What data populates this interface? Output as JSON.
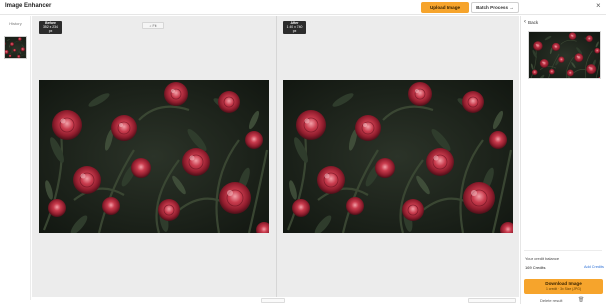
{
  "app": {
    "title": "Image Enhancer"
  },
  "toolbar": {
    "upload_label": "Upload Image",
    "batch_label": "Batch Process →",
    "close_glyph": "×"
  },
  "history": {
    "label": "History"
  },
  "compare": {
    "before_title": "Before",
    "before_size": "352 x 234 px",
    "after_title": "After",
    "after_size": "1 40 x 740 px",
    "chip_label": "⌕ Fit"
  },
  "side_panel": {
    "back_label": "Back",
    "credit_text": "Your credit balance",
    "credit_amount": "169 Credits",
    "add_credits_label": "Add Credits",
    "download_label": "Download Image",
    "download_sub": "1 credit · 3x Size (JPG)",
    "delete_label": "Delete result"
  },
  "icons": {
    "back": "chevron-left-icon",
    "close": "close-icon",
    "trash": "trash-icon"
  },
  "colors": {
    "accent": "#f6a42c",
    "link": "#2b6fd6",
    "canvas": "#ececec",
    "tag": "#2c2c2c"
  }
}
